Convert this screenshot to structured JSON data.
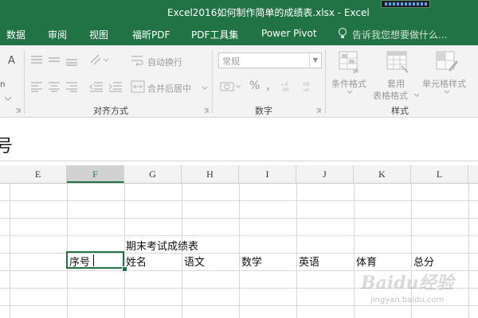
{
  "window": {
    "title": "Excel2016如何制作简单的成绩表.xlsx - Excel"
  },
  "tabs": [
    {
      "label": "数据"
    },
    {
      "label": "审阅"
    },
    {
      "label": "视图"
    },
    {
      "label": "福昕PDF"
    },
    {
      "label": "PDF工具集"
    },
    {
      "label": "Power Pivot"
    }
  ],
  "tell_me": {
    "text": "告诉我您想要做什么..."
  },
  "ribbon": {
    "font_group": {
      "partial_letter": "A",
      "partial_label": "ēn"
    },
    "alignment": {
      "wrap_text": "自动换行",
      "merge_center": "合并后居中",
      "group_label": "对齐方式"
    },
    "number": {
      "format_value": "常规",
      "percent_symbol": "%",
      "comma_symbol": ",",
      "group_label": "数字"
    },
    "styles": {
      "conditional": "条件格式",
      "table_line1": "套用",
      "table_line2": "表格格式",
      "cell_styles": "单元格样式",
      "group_label": "样式"
    }
  },
  "formula_bar": {
    "content": "号"
  },
  "columns": [
    "E",
    "F",
    "G",
    "H",
    "I",
    "J",
    "K",
    "L"
  ],
  "active_column": "F",
  "sheet": {
    "title_cell": "期末考试成绩表",
    "headers": [
      "序号",
      "姓名",
      "语文",
      "数学",
      "英语",
      "体育",
      "总分"
    ]
  },
  "watermark": {
    "logo": "Baidu经验",
    "url": "jingyan.baidu.com"
  }
}
